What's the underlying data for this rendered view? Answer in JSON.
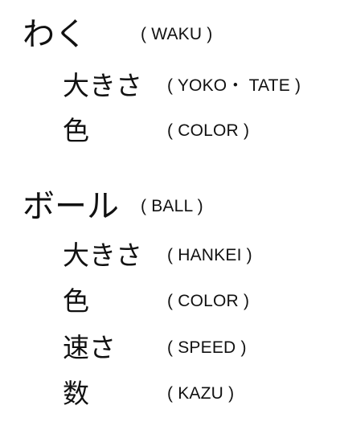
{
  "sections": [
    {
      "label": "わく",
      "reading": "( WAKU )",
      "items": [
        {
          "label": "大きさ",
          "reading": "( YOKO・ TATE )"
        },
        {
          "label": "色",
          "reading": "( COLOR )"
        }
      ]
    },
    {
      "label": "ボール",
      "reading": "( BALL )",
      "items": [
        {
          "label": "大きさ",
          "reading": "( HANKEI )"
        },
        {
          "label": "色",
          "reading": "( COLOR )"
        },
        {
          "label": "速さ",
          "reading": "( SPEED )"
        },
        {
          "label": "数",
          "reading": "( KAZU )"
        }
      ]
    }
  ]
}
